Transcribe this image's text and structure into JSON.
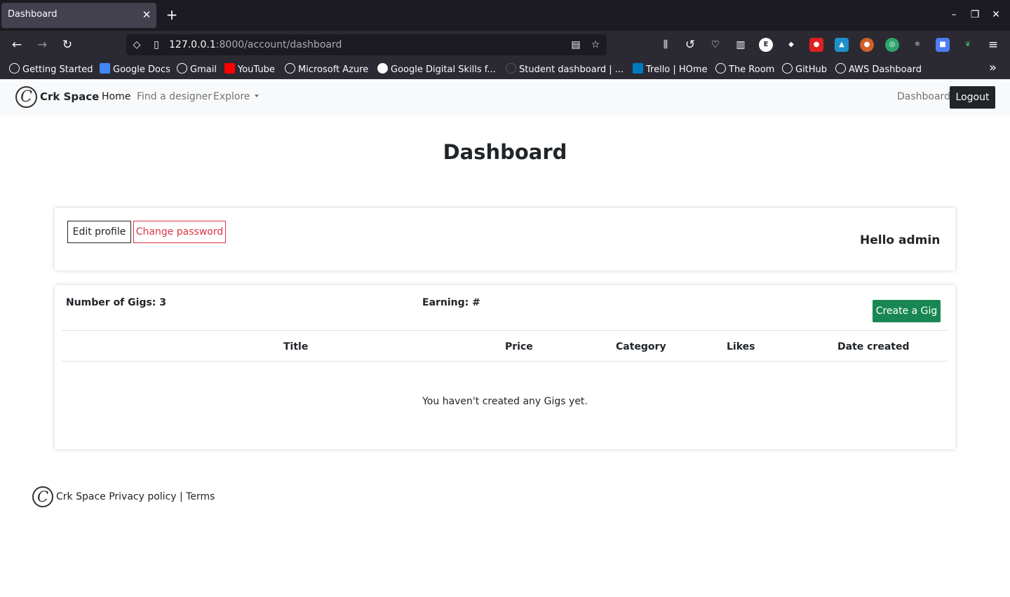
{
  "browser": {
    "tab_title": "Dashboard",
    "tab_close": "✕",
    "new_tab": "+",
    "url_host": "127.0.0.1",
    "url_rest": ":8000/account/dashboard",
    "win_minimize": "–",
    "win_restore": "❐",
    "win_close": "✕",
    "back": "←",
    "forward": "→",
    "reload": "↻",
    "menu": "≡",
    "bookmarks": [
      {
        "label": "Getting Started"
      },
      {
        "label": "Google Docs"
      },
      {
        "label": "Gmail"
      },
      {
        "label": "YouTube"
      },
      {
        "label": "Microsoft Azure"
      },
      {
        "label": "Google Digital Skills f..."
      },
      {
        "label": "Student dashboard | ..."
      },
      {
        "label": "Trello | HOme"
      },
      {
        "label": "The Room"
      },
      {
        "label": "GitHub"
      },
      {
        "label": "AWS Dashboard"
      }
    ],
    "bookmarks_overflow": "»"
  },
  "site": {
    "brand": "Crk Space",
    "logo_glyph": "C",
    "nav": {
      "home": "Home",
      "find_designer": "Find a designer",
      "explore": "Explore",
      "dashboard": "Dashboard",
      "logout": "Logout"
    }
  },
  "page": {
    "title": "Dashboard",
    "profile_card": {
      "edit_profile": "Edit profile",
      "change_password": "Change password",
      "greeting": "Hello admin"
    },
    "gigs_card": {
      "gig_count": "Number of Gigs: 3",
      "earning": "Earning: #",
      "create_button": "Create a Gig",
      "columns": [
        "Title",
        "Price",
        "Category",
        "Likes",
        "Date created"
      ],
      "empty_message": "You haven't created any Gigs yet."
    }
  },
  "footer": {
    "text": "Crk Space Privacy policy | Terms"
  },
  "colors": {
    "danger": "#dc3545",
    "success": "#198754",
    "dark": "#212529"
  }
}
